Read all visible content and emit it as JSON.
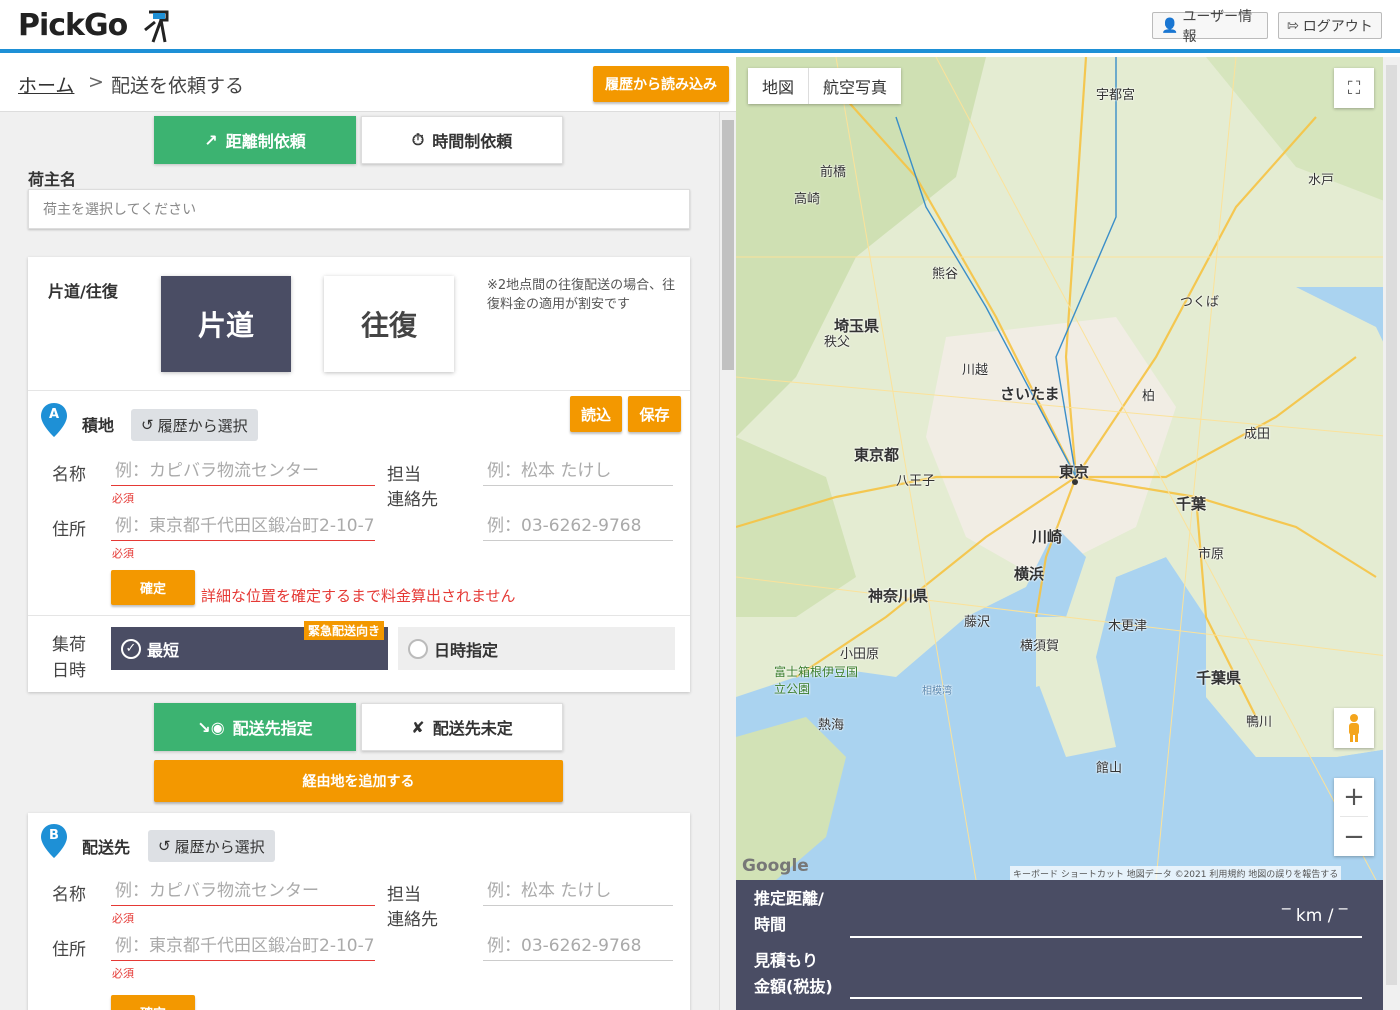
{
  "header": {
    "logo": "PickGo",
    "user_info": "ユーザー情報",
    "logout": "ログアウト"
  },
  "breadcrumb": {
    "home": "ホーム",
    "separator": ">",
    "current": "配送を依頼する"
  },
  "load_history_button": "履歴から読み込み",
  "request_type": {
    "distance": "距離制依頼",
    "time": "時間制依頼"
  },
  "shipper": {
    "label": "荷主名",
    "placeholder": "荷主を選択してください"
  },
  "trip": {
    "label": "片道/往復",
    "one_way": "片道",
    "round_trip": "往復",
    "note": "※2地点間の往復配送の場合、往復料金の適用が割安です"
  },
  "pickup": {
    "pin": "A",
    "title": "積地",
    "history": "履歴から選択",
    "load": "読込",
    "save": "保存",
    "name_label": "名称",
    "name_placeholder": "例：カピバラ物流センター",
    "required": "必須",
    "contact_label_1": "担当",
    "contact_label_2": "連絡先",
    "contact_name_placeholder": "例：松本 たけし",
    "address_label": "住所",
    "address_placeholder": "例：東京都千代田区鍛冶町2-10-7",
    "phone_placeholder": "例：03-6262-9768",
    "confirm": "確定",
    "warning": "詳細な位置を確定するまで料金算出されません"
  },
  "collection": {
    "label_1": "集荷",
    "label_2": "日時",
    "shortest": "最短",
    "badge": "緊急配送向き",
    "specify": "日時指定"
  },
  "destination_mode": {
    "specified": "配送先指定",
    "unspecified": "配送先未定",
    "add_waypoint": "経由地を追加する"
  },
  "delivery": {
    "pin": "B",
    "title": "配送先",
    "history": "履歴から選択",
    "name_label": "名称",
    "name_placeholder": "例：カピバラ物流センター",
    "required": "必須",
    "contact_label_1": "担当",
    "contact_label_2": "連絡先",
    "contact_name_placeholder": "例：松本 たけし",
    "address_label": "住所",
    "address_placeholder": "例：東京都千代田区鍛冶町2-10-7",
    "phone_placeholder": "例：03-6262-9768",
    "confirm": "確定"
  },
  "map": {
    "tab_map": "地図",
    "tab_aerial": "航空写真",
    "labels": {
      "saitama": "さいたま",
      "tokyo": "東京",
      "chiba": "千葉",
      "yokohama": "横浜",
      "kawasaki": "川崎",
      "saitama_pref": "埼玉県",
      "tokyo_to": "東京都",
      "kanagawa": "神奈川県",
      "chiba_pref": "千葉県",
      "maebashi": "前橋",
      "takasaki": "高崎",
      "kumagaya": "熊谷",
      "kawagoe": "川越",
      "hachioji": "八王子",
      "odawara": "小田原",
      "atami": "熱海",
      "tsukuba": "つくば",
      "mito": "水戸",
      "utsunomiya": "宇都宮",
      "kisarazu": "木更津",
      "kamogawa": "鴨川",
      "tateyama": "館山",
      "yokosuka": "横須賀",
      "fujisawa": "藤沢",
      "hakone": "富士箱根伊豆国立公園",
      "chichibu": "秩父",
      "kashiwa": "柏",
      "narita": "成田",
      "ichihara": "市原",
      "sagamiwan": "相模湾"
    },
    "google": "Google",
    "footer": "キーボード ショートカット 地図データ ©2021 利用規約 地図の誤りを報告する",
    "zoom_in": "+",
    "zoom_out": "−"
  },
  "estimate": {
    "distance_label_1": "推定距離/",
    "distance_label_2": "時間",
    "distance_value": "‾ km / ‾",
    "price_label_1": "見積もり",
    "price_label_2": "金額(税抜)"
  },
  "colors": {
    "accent_orange": "#f39800",
    "green": "#3cb371",
    "dark_navy": "#4a4d64",
    "header_blue": "#1e90d6",
    "required_red": "#e53935"
  }
}
